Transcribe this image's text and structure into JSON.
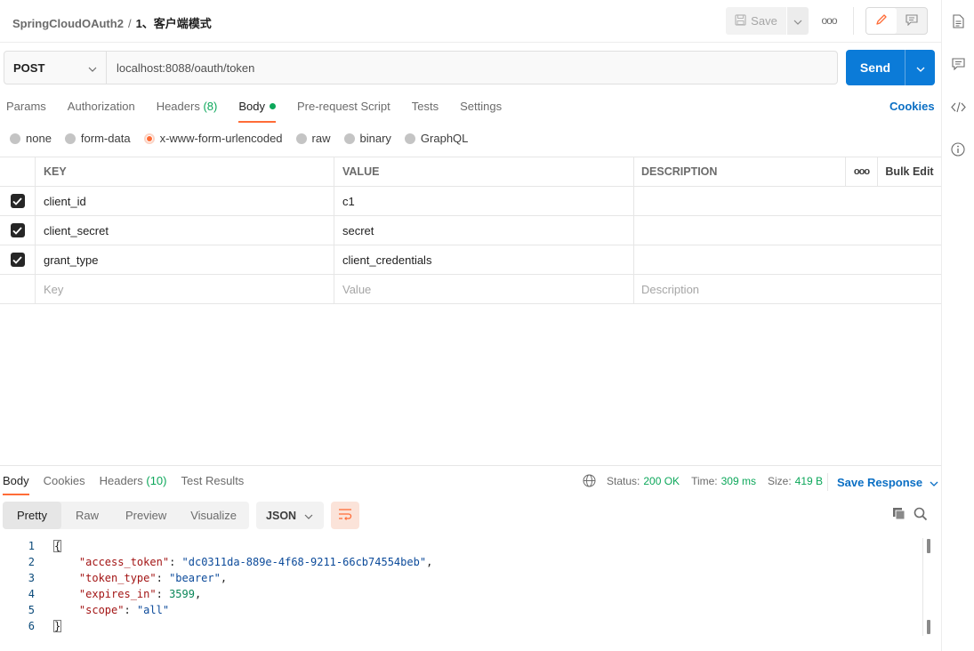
{
  "header": {
    "collection": "SpringCloudOAuth2",
    "separator": "/",
    "request_name": "1、客户端模式",
    "save_label": "Save",
    "more_label": "ooo"
  },
  "request": {
    "method": "POST",
    "url": "localhost:8088/oauth/token",
    "send_label": "Send"
  },
  "request_tabs": {
    "params": "Params",
    "authorization": "Authorization",
    "headers": "Headers",
    "headers_count": "(8)",
    "body": "Body",
    "prerequest": "Pre-request Script",
    "tests": "Tests",
    "settings": "Settings",
    "cookies": "Cookies"
  },
  "body_types": {
    "none": "none",
    "form_data": "form-data",
    "urlencoded": "x-www-form-urlencoded",
    "raw": "raw",
    "binary": "binary",
    "graphql": "GraphQL"
  },
  "params_table": {
    "headers": {
      "key": "KEY",
      "value": "VALUE",
      "description": "DESCRIPTION",
      "more": "ooo",
      "bulk_edit": "Bulk Edit"
    },
    "rows": [
      {
        "key": "client_id",
        "value": "c1",
        "description": ""
      },
      {
        "key": "client_secret",
        "value": "secret",
        "description": ""
      },
      {
        "key": "grant_type",
        "value": "client_credentials",
        "description": ""
      }
    ],
    "placeholders": {
      "key": "Key",
      "value": "Value",
      "description": "Description"
    }
  },
  "response": {
    "tabs": {
      "body": "Body",
      "cookies": "Cookies",
      "headers": "Headers",
      "headers_count": "(10)",
      "test_results": "Test Results"
    },
    "status_label": "Status:",
    "status_value": "200 OK",
    "time_label": "Time:",
    "time_value": "309 ms",
    "size_label": "Size:",
    "size_value": "419 B",
    "save_response": "Save Response",
    "formats": {
      "pretty": "Pretty",
      "raw": "Raw",
      "preview": "Preview",
      "visualize": "Visualize"
    },
    "language": "JSON",
    "code_lines": [
      {
        "num": "1",
        "open": "{"
      },
      {
        "num": "2",
        "key": "\"access_token\"",
        "val": "\"dc0311da-889e-4f68-9211-66cb74554beb\"",
        "type": "s",
        "trail": ","
      },
      {
        "num": "3",
        "key": "\"token_type\"",
        "val": "\"bearer\"",
        "type": "s",
        "trail": ","
      },
      {
        "num": "4",
        "key": "\"expires_in\"",
        "val": "3599",
        "type": "n",
        "trail": ","
      },
      {
        "num": "5",
        "key": "\"scope\"",
        "val": "\"all\"",
        "type": "s",
        "trail": ""
      },
      {
        "num": "6",
        "close": "}"
      }
    ]
  },
  "colors": {
    "accent": "#ff6c37",
    "send_blue": "#0b7bd8",
    "link_blue": "#0b6fc4",
    "status_green": "#0ca75a"
  }
}
